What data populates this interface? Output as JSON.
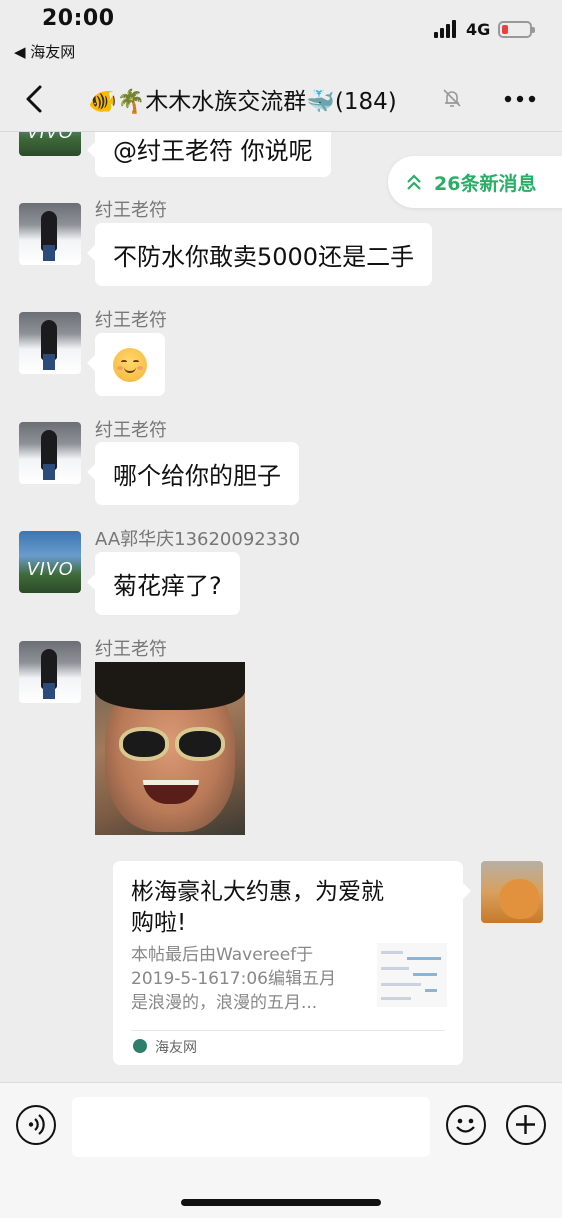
{
  "status": {
    "time": "20:00",
    "back_app": "◀ 海友网",
    "network": "4G",
    "battery_color": "#e64340"
  },
  "nav": {
    "back_icon": "chevron-left-icon",
    "title": "🐠🌴木木水族交流群🐳(184)",
    "mute_icon": "mute-bell-icon",
    "more_icon": "more-icon"
  },
  "new_messages": {
    "label": "26条新消息",
    "color": "#2aae67"
  },
  "messages": [
    {
      "sender": "",
      "text": "@纣王老符 你说呢",
      "avatar": "vivo-avatar"
    },
    {
      "sender": "纣王老符",
      "text": "不防水你敢卖5000还是二手",
      "avatar": "snow-person-avatar"
    },
    {
      "sender": "纣王老符",
      "text": "",
      "emoji": "blush-smile-emoji",
      "avatar": "snow-person-avatar"
    },
    {
      "sender": "纣王老符",
      "text": "哪个给你的胆子",
      "avatar": "snow-person-avatar"
    },
    {
      "sender": "AA郭华庆13620092330",
      "text": "菊花痒了?",
      "avatar": "vivo-avatar"
    },
    {
      "sender": "纣王老符",
      "text": "",
      "image": "sunglasses-man-meme",
      "avatar": "snow-person-avatar"
    }
  ],
  "avatar_brand": "VIVO",
  "link_card": {
    "title": "彬海豪礼大约惠，为爱就\n购啦!",
    "description": "本帖最后由Wavereef于\n2019-5-1617:06编辑五月\n是浪漫的，浪漫的五月...",
    "source": "海友网"
  },
  "input_bar": {
    "voice_icon": "voice-icon",
    "emoji_icon": "emoji-icon",
    "plus_icon": "plus-icon",
    "input_value": ""
  }
}
